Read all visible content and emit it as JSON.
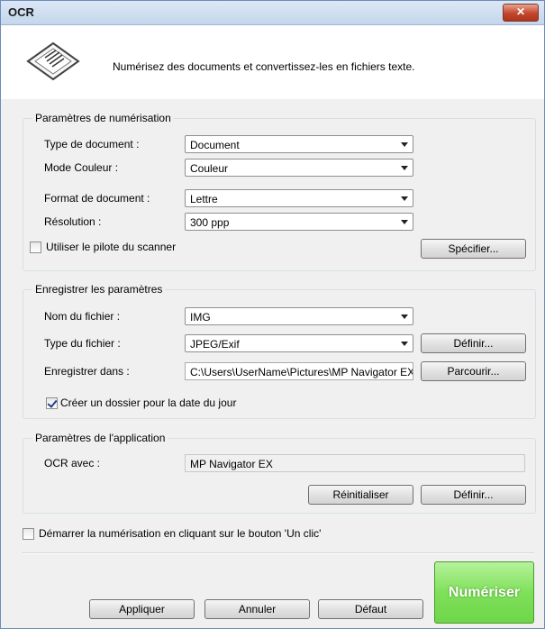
{
  "window": {
    "title": "OCR",
    "close_glyph": "✕"
  },
  "header": {
    "icon": "document-icon",
    "description": "Numérisez des documents et convertissez-les en fichiers texte."
  },
  "scan_settings": {
    "title": "Paramètres de numérisation",
    "document_type": {
      "label": "Type de document :",
      "value": "Document"
    },
    "color_mode": {
      "label": "Mode Couleur :",
      "value": "Couleur"
    },
    "document_size": {
      "label": "Format de document :",
      "value": "Lettre"
    },
    "resolution": {
      "label": "Résolution :",
      "value": "300 ppp"
    },
    "use_scanner_driver": {
      "label": "Utiliser le pilote du scanner",
      "checked": false
    },
    "specify_label": "Spécifier..."
  },
  "save_settings": {
    "title": "Enregistrer les paramètres",
    "file_name": {
      "label": "Nom du fichier :",
      "value": "IMG"
    },
    "file_type": {
      "label": "Type du fichier :",
      "value": "JPEG/Exif"
    },
    "set_label": "Définir...",
    "save_in": {
      "label": "Enregistrer dans :",
      "value": "C:\\Users\\UserName\\Pictures\\MP Navigator EX"
    },
    "browse_label": "Parcourir...",
    "create_subfolder": {
      "label": "Créer un dossier pour la date du jour",
      "checked": true
    }
  },
  "app_settings": {
    "title": "Paramètres de l'application",
    "ocr_with": {
      "label": "OCR avec :",
      "value": "MP Navigator EX"
    },
    "reset_label": "Réinitialiser",
    "set_label": "Définir..."
  },
  "one_click": {
    "label": "Démarrer la numérisation en cliquant sur le bouton 'Un clic'",
    "checked": false
  },
  "footer": {
    "apply_label": "Appliquer",
    "cancel_label": "Annuler",
    "default_label": "Défaut",
    "scan_label": "Numériser"
  },
  "colors": {
    "scan_button": "#7fe05a",
    "title_bar": "#c5d6ec",
    "close_button": "#c2452b"
  }
}
